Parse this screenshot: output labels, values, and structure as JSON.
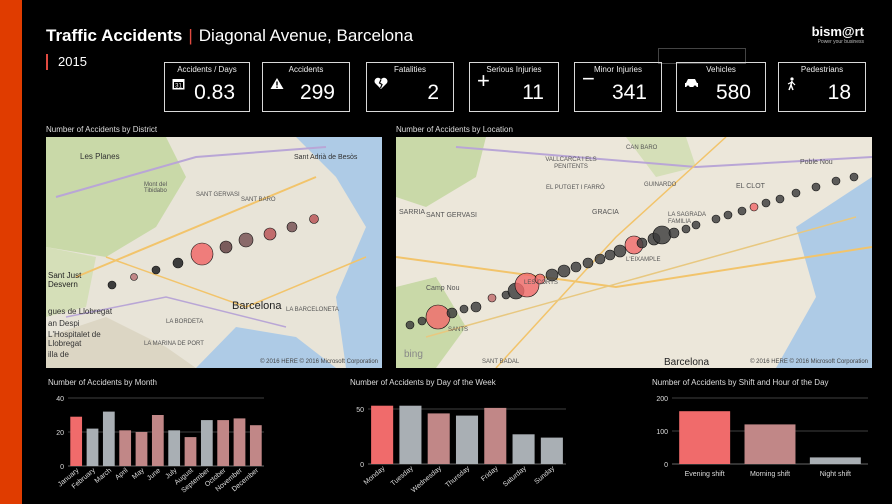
{
  "header": {
    "title_bold": "Traffic Accidents",
    "title_rest_1": "Diagonal Avenue,",
    "title_rest_2": "Barcelona",
    "year": "2015",
    "brand": "bism@rt",
    "brand_tagline": "Power your business"
  },
  "kpis": [
    {
      "label": "Accidents / Days",
      "value": "0.83",
      "icon": "calendar-icon"
    },
    {
      "label": "Accidents",
      "value": "299",
      "icon": "warning-icon"
    },
    {
      "label": "Fatalities",
      "value": "2",
      "icon": "broken-heart-icon"
    },
    {
      "label": "Serious Injuries",
      "value": "11",
      "icon": "plus-icon"
    },
    {
      "label": "Minor Injuries",
      "value": "341",
      "icon": "minus-icon"
    },
    {
      "label": "Vehicles",
      "value": "580",
      "icon": "car-icon"
    },
    {
      "label": "Pedestrians",
      "value": "18",
      "icon": "pedestrian-icon"
    }
  ],
  "maps": {
    "district": {
      "title": "Number of Accidents by District",
      "labels": [
        "Les Planes",
        "Sant Adrià de Besòs",
        "Mont del Tibidabo",
        "SANT GERVASI",
        "Sant Just Desvern",
        "Barcelona",
        "gues de Llobregat",
        "an Despi",
        "L'Hospitalet de Llobregat",
        "illa de",
        "LA BORDETA",
        "LA MARINA DE PORT",
        "SANT BARO",
        "LA BARCELONETA"
      ],
      "copyright": "© 2016 HERE   © 2016 Microsoft Corporation"
    },
    "location": {
      "title": "Number of Accidents by Location",
      "labels": [
        "SANT GERVASI",
        "GRACIA",
        "SARRIA",
        "VALLCARCA I ELS PENITENTS",
        "EL PUTGET I FARRÓ",
        "CAN BARO",
        "GUINARDO",
        "EL CLOT",
        "LA SAGRADA FAMILIA",
        "L'EIXAMPLE",
        "LES CORTS",
        "Camp Nou",
        "Barcelona",
        "SANTS",
        "SANT BADAL",
        "Poble Nou"
      ],
      "copyright": "© 2016 HERE   © 2016 Microsoft Corporation",
      "bing": "bing"
    }
  },
  "colors": {
    "highlight": "#f06b6b",
    "muted": "#c18787",
    "neutral": "#a9afb4",
    "bubble_dark": "#3c3c3c"
  },
  "chart_data": [
    {
      "type": "bar",
      "title": "Number of Accidents by Month",
      "categories": [
        "January",
        "February",
        "March",
        "April",
        "May",
        "June",
        "July",
        "August",
        "September",
        "October",
        "November",
        "December"
      ],
      "values": [
        29,
        22,
        32,
        21,
        20,
        30,
        21,
        17,
        27,
        27,
        28,
        24
      ],
      "bar_colors": [
        "#f06b6b",
        "#a9afb4",
        "#a9afb4",
        "#c18787",
        "#c18787",
        "#c18787",
        "#a9afb4",
        "#c18787",
        "#a9afb4",
        "#c18787",
        "#c18787",
        "#c18787"
      ],
      "yticks": [
        0,
        20,
        40
      ],
      "ylim": [
        0,
        40
      ],
      "grid": true
    },
    {
      "type": "bar",
      "title": "Number of Accidents by Day of the Week",
      "categories": [
        "Monday",
        "Tuesday",
        "Wednesday",
        "Thursday",
        "Friday",
        "Saturday",
        "Sunday"
      ],
      "values": [
        53,
        53,
        46,
        44,
        51,
        27,
        24
      ],
      "bar_colors": [
        "#f06b6b",
        "#a9afb4",
        "#c18787",
        "#a9afb4",
        "#c18787",
        "#a9afb4",
        "#a9afb4"
      ],
      "yticks": [
        0,
        50
      ],
      "ylim": [
        0,
        60
      ],
      "grid": true
    },
    {
      "type": "bar",
      "title": "Number of Accidents by Shift and Hour of the Day",
      "categories": [
        "Evening shift",
        "Morning shift",
        "Night shift"
      ],
      "values": [
        160,
        120,
        20
      ],
      "bar_colors": [
        "#f06b6b",
        "#c18787",
        "#a9afb4"
      ],
      "yticks": [
        0,
        100,
        200
      ],
      "ylim": [
        0,
        200
      ],
      "grid": true
    }
  ]
}
